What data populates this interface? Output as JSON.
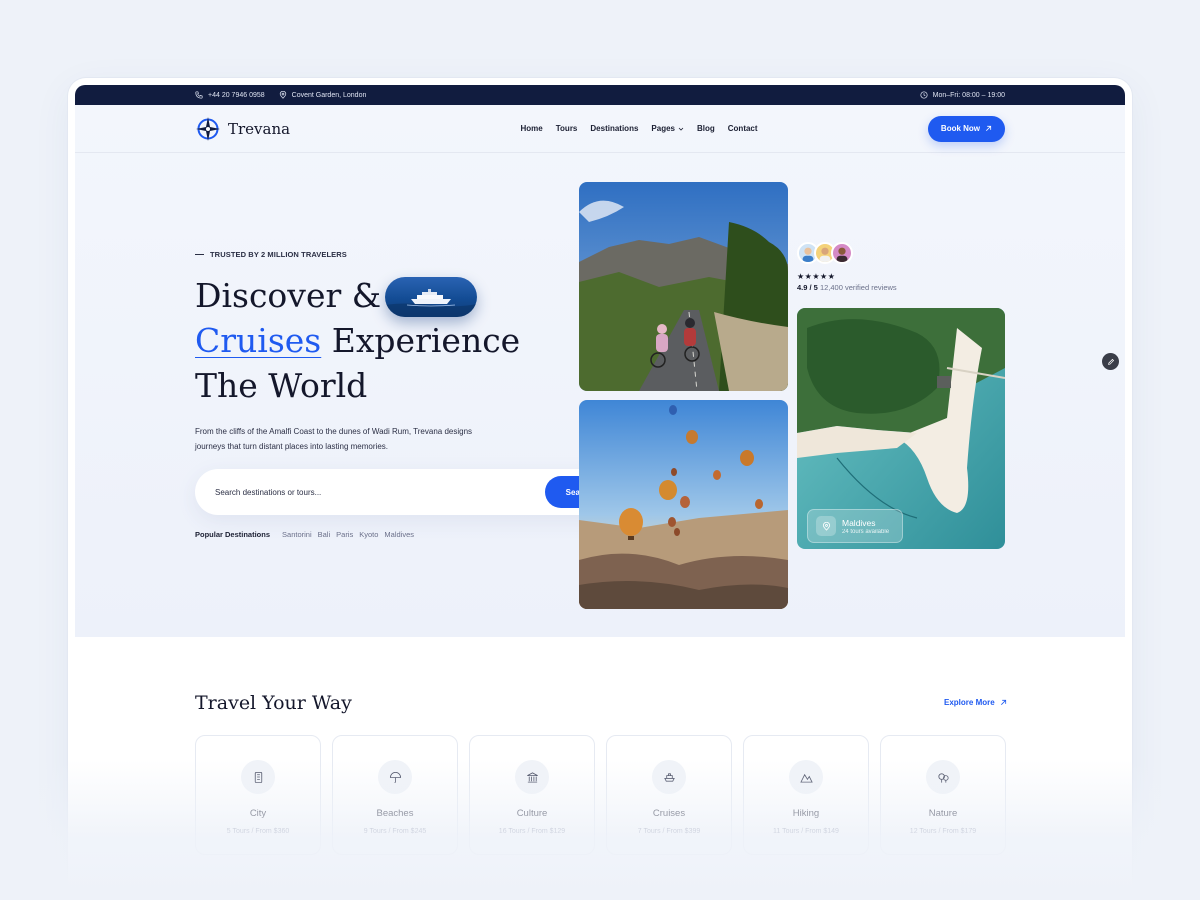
{
  "topbar": {
    "phone": "+44 20 7946 0958",
    "location": "Covent Garden, London",
    "hours": "Mon–Fri: 08:00 – 19:00"
  },
  "nav": {
    "brand": "Trevana",
    "links": [
      "Home",
      "Tours",
      "Destinations",
      "Pages",
      "Blog",
      "Contact"
    ],
    "cta": "Book Now"
  },
  "hero": {
    "eyebrow": "TRUSTED BY 2 MILLION TRAVELERS",
    "title_line1": "Discover &",
    "title_highlight": "Cruises",
    "title_line2_rest": "Experience",
    "title_line3": "The World",
    "description": "From the cliffs of the Amalfi Coast to the dunes of Wadi Rum, Trevana designs journeys that turn distant places into lasting memories.",
    "search": {
      "placeholder": "Search destinations or tours...",
      "button": "Search"
    },
    "popular_label": "Popular Destinations",
    "popular": [
      "Santorini",
      "Bali",
      "Paris",
      "Kyoto",
      "Maldives"
    ]
  },
  "reviews": {
    "stars": "★★★★★",
    "score": "4.9 / 5",
    "count": "12,400 verified reviews"
  },
  "featured": {
    "name": "Maldives",
    "tours": "24 tours available"
  },
  "section": {
    "title": "Travel Your Way",
    "explore": "Explore More",
    "categories": [
      {
        "name": "City",
        "meta": "5 Tours / From $360",
        "icon": "building-icon"
      },
      {
        "name": "Beaches",
        "meta": "9 Tours / From $245",
        "icon": "umbrella-icon"
      },
      {
        "name": "Culture",
        "meta": "16 Tours / From $129",
        "icon": "museum-icon"
      },
      {
        "name": "Cruises",
        "meta": "7 Tours / From $399",
        "icon": "ship-icon"
      },
      {
        "name": "Hiking",
        "meta": "11 Tours / From $149",
        "icon": "mountain-icon"
      },
      {
        "name": "Nature",
        "meta": "12 Tours / From $179",
        "icon": "tree-icon"
      }
    ]
  },
  "colors": {
    "accent": "#1f5af0",
    "navy": "#111c3f",
    "text": "#14172b"
  }
}
